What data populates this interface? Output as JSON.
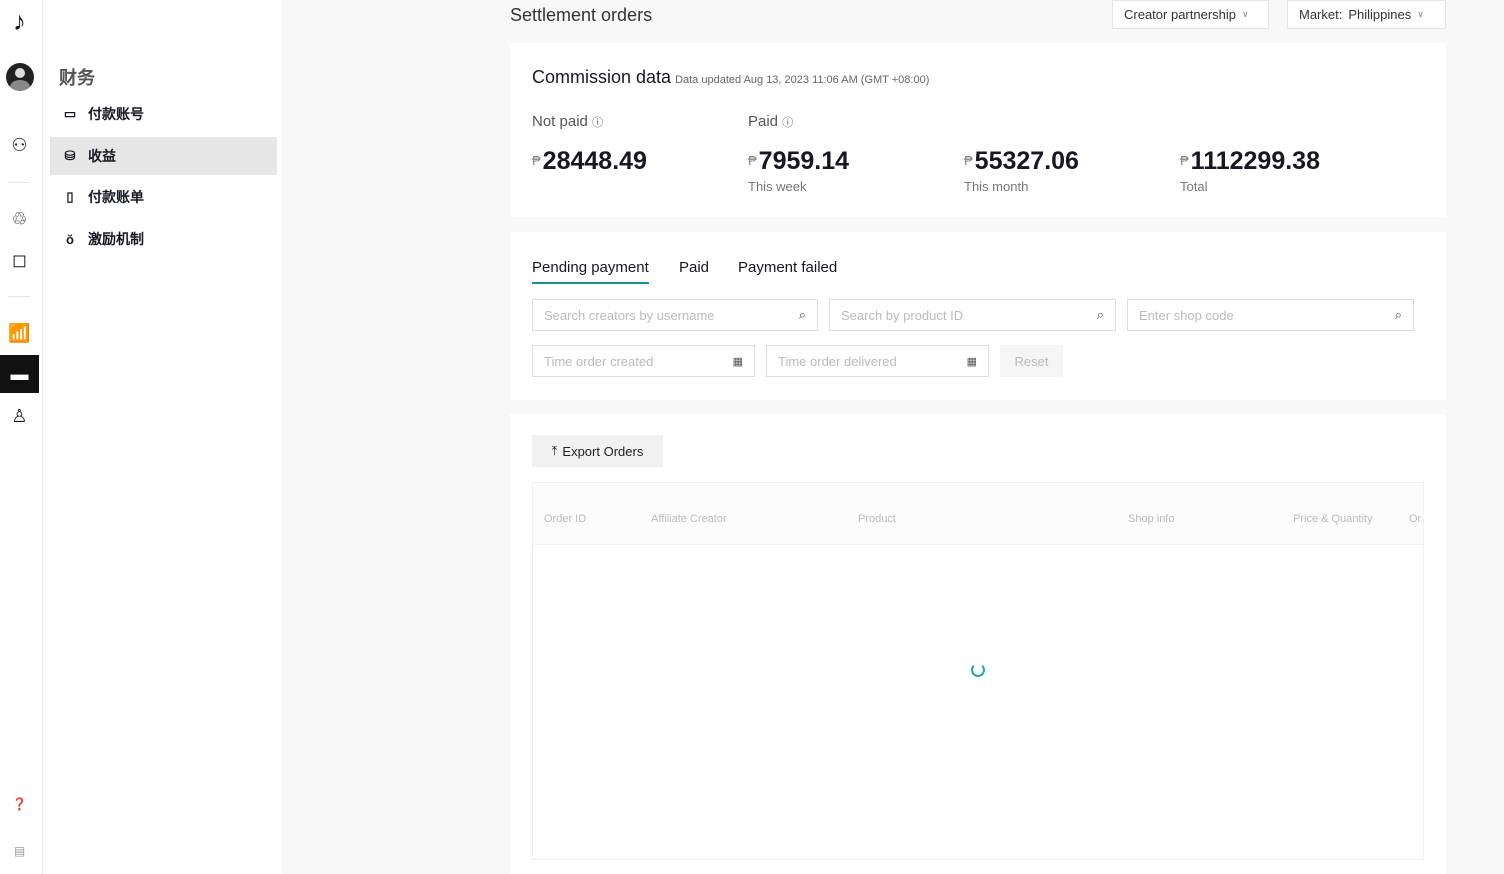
{
  "rail": {
    "icons": [
      "tiktok-logo-icon",
      "avatar-icon",
      "creator-star-icon",
      "affiliate-network-icon",
      "shop-bag-icon",
      "analytics-chart-icon",
      "finance-card-icon",
      "account-user-icon",
      "help-icon",
      "notes-icon"
    ]
  },
  "sidebar": {
    "heading": "财务",
    "items": [
      {
        "label": "付款账号",
        "icon": "wallet-icon"
      },
      {
        "label": "收益",
        "icon": "coins-icon"
      },
      {
        "label": "付款账单",
        "icon": "bill-icon"
      },
      {
        "label": "激励机制",
        "icon": "medal-icon"
      }
    ]
  },
  "header": {
    "title": "Settlement orders",
    "partnership": "Creator partnership",
    "market_label": "Market:",
    "market_value": "Philippines"
  },
  "commission": {
    "title": "Commission data",
    "updated": "Data updated Aug 13, 2023 11:06 AM (GMT +08:00)",
    "currency": "₱",
    "not_paid_label": "Not paid",
    "paid_label": "Paid",
    "not_paid": "28448.49",
    "week": "7959.14",
    "week_label": "This week",
    "month": "55327.06",
    "month_label": "This month",
    "total": "1112299.38",
    "total_label": "Total"
  },
  "filters": {
    "tabs": [
      "Pending payment",
      "Paid",
      "Payment failed"
    ],
    "search_creator": "Search creators by username",
    "search_product": "Search by product ID",
    "shop_code": "Enter shop code",
    "time_created": "Time order created",
    "time_delivered": "Time order delivered",
    "reset": "Reset"
  },
  "orders": {
    "export": "Export Orders",
    "columns": [
      "Order ID",
      "Affiliate Creator",
      "Product",
      "Shop info",
      "Price & Quantity",
      "Or"
    ]
  }
}
